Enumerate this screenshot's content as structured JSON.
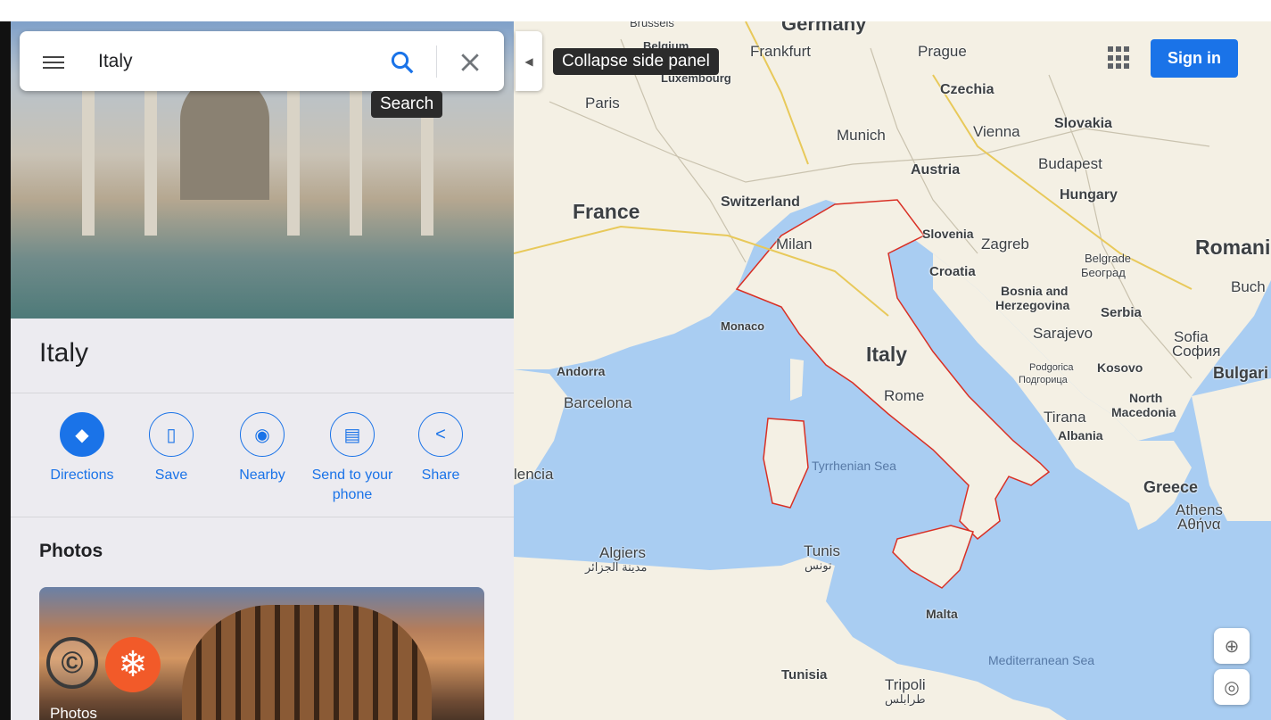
{
  "search": {
    "query": "Italy",
    "search_tooltip": "Search"
  },
  "side_panel": {
    "collapse_tooltip": "Collapse side panel"
  },
  "place": {
    "title": "Italy",
    "actions": [
      {
        "label": "Directions",
        "icon": "directions-icon"
      },
      {
        "label": "Save",
        "icon": "bookmark-icon"
      },
      {
        "label": "Nearby",
        "icon": "nearby-icon"
      },
      {
        "label": "Send to your phone",
        "icon": "send-to-phone-icon"
      },
      {
        "label": "Share",
        "icon": "share-icon"
      }
    ],
    "photos_heading": "Photos",
    "photo_card_label": "Photos"
  },
  "header": {
    "signin_label": "Sign in"
  },
  "colors": {
    "accent": "#1a73e8",
    "border": "#d93025",
    "sea": "#a9cdf2",
    "land": "#f4f0e4"
  },
  "map_labels": {
    "germany": "Germany",
    "brussels": "Brussels",
    "belgium": "Belgium",
    "luxembourg": "Luxembourg",
    "frankfurt": "Frankfurt",
    "prague": "Prague",
    "czechia": "Czechia",
    "paris": "Paris",
    "munich": "Munich",
    "vienna": "Vienna",
    "slovakia": "Slovakia",
    "austria": "Austria",
    "budapest": "Budapest",
    "hungary": "Hungary",
    "france": "France",
    "switzerland": "Switzerland",
    "slovenia": "Slovenia",
    "zagreb": "Zagreb",
    "romania": "Romani",
    "milan": "Milan",
    "belgrade": "Belgrade",
    "belgrade_cyr": "Београд",
    "croatia": "Croatia",
    "buch": "Buch",
    "bosnia": "Bosnia and",
    "herzegovina": "Herzegovina",
    "serbia": "Serbia",
    "sarajevo": "Sarajevo",
    "monaco": "Monaco",
    "sofia": "Sofia",
    "sofia_cyr": "София",
    "italy": "Italy",
    "andorra": "Andorra",
    "podgorica": "Podgorica",
    "podgorica_cyr": "Подгорица",
    "kosovo": "Kosovo",
    "bulgaria": "Bulgari",
    "rome": "Rome",
    "barcelona": "Barcelona",
    "north": "North",
    "macedonia": "Macedonia",
    "tirana": "Tirana",
    "albania": "Albania",
    "tyrrhenian": "Tyrrhenian Sea",
    "valencia": "lencia",
    "greece": "Greece",
    "athens": "Athens",
    "athens_gr": "Αθήνα",
    "algiers": "Algiers",
    "algiers_ar": "مدينة الجزائر",
    "tunis": "Tunis",
    "tunis_ar": "تونس",
    "malta": "Malta",
    "mediterranean": "Mediterranean Sea",
    "tunisia": "Tunisia",
    "tripoli": "Tripoli",
    "tripoli_ar": "طرابلس"
  }
}
